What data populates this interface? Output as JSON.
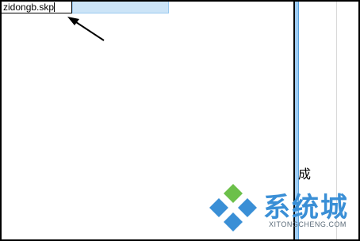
{
  "rename_field": {
    "value": "zidongb.skp"
  },
  "right_pane": {
    "partial_text": "成"
  },
  "watermark": {
    "title": "系统城",
    "url": "XITONGCHENG.COM"
  },
  "colors": {
    "selection": "#cce4f7",
    "splitter": "#9fcdf4",
    "watermark_blue": "#3a8fd6",
    "watermark_green": "#6cc04a"
  },
  "icons": [
    "arrow-pointer-icon",
    "diamond-logo-icon"
  ]
}
